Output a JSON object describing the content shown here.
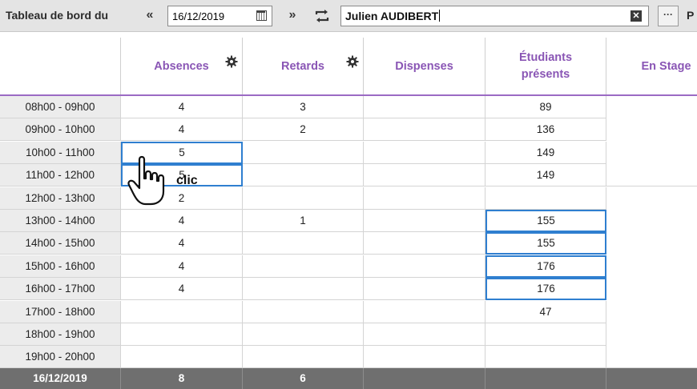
{
  "toolbar": {
    "label": "Tableau de bord du",
    "prev_icon": "«",
    "next_icon": "»",
    "date": "16/12/2019",
    "user": "Julien AUDIBERT",
    "clear_icon": "✕",
    "more_button": "···",
    "more_label": "P"
  },
  "columns": {
    "absences": "Absences",
    "retards": "Retards",
    "dispenses": "Dispenses",
    "etudiants": "Étudiants présents",
    "stage": "En Stage"
  },
  "rows": [
    {
      "time": "08h00 - 09h00",
      "abs": "4",
      "ret": "3",
      "disp": "",
      "etu": "89"
    },
    {
      "time": "09h00 - 10h00",
      "abs": "4",
      "ret": "2",
      "disp": "",
      "etu": "136"
    },
    {
      "time": "10h00 - 11h00",
      "abs": "5",
      "ret": "",
      "disp": "",
      "etu": "149"
    },
    {
      "time": "11h00 - 12h00",
      "abs": "5",
      "ret": "",
      "disp": "",
      "etu": "149"
    },
    {
      "time": "12h00 - 13h00",
      "abs": "2",
      "ret": "",
      "disp": "",
      "etu": ""
    },
    {
      "time": "13h00 - 14h00",
      "abs": "4",
      "ret": "1",
      "disp": "",
      "etu": "155"
    },
    {
      "time": "14h00 - 15h00",
      "abs": "4",
      "ret": "",
      "disp": "",
      "etu": "155"
    },
    {
      "time": "15h00 - 16h00",
      "abs": "4",
      "ret": "",
      "disp": "",
      "etu": "176"
    },
    {
      "time": "16h00 - 17h00",
      "abs": "4",
      "ret": "",
      "disp": "",
      "etu": "176"
    },
    {
      "time": "17h00 - 18h00",
      "abs": "",
      "ret": "",
      "disp": "",
      "etu": "47"
    },
    {
      "time": "18h00 - 19h00",
      "abs": "",
      "ret": "",
      "disp": "",
      "etu": ""
    },
    {
      "time": "19h00 - 20h00",
      "abs": "",
      "ret": "",
      "disp": "",
      "etu": ""
    }
  ],
  "footer": {
    "date": "16/12/2019",
    "abs_total": "8",
    "ret_total": "6"
  },
  "annotation": {
    "clic": "clic"
  },
  "colors": {
    "header_text": "#8a56b5",
    "selection": "#2f7fd0",
    "footer_bg": "#6f6f6f"
  }
}
